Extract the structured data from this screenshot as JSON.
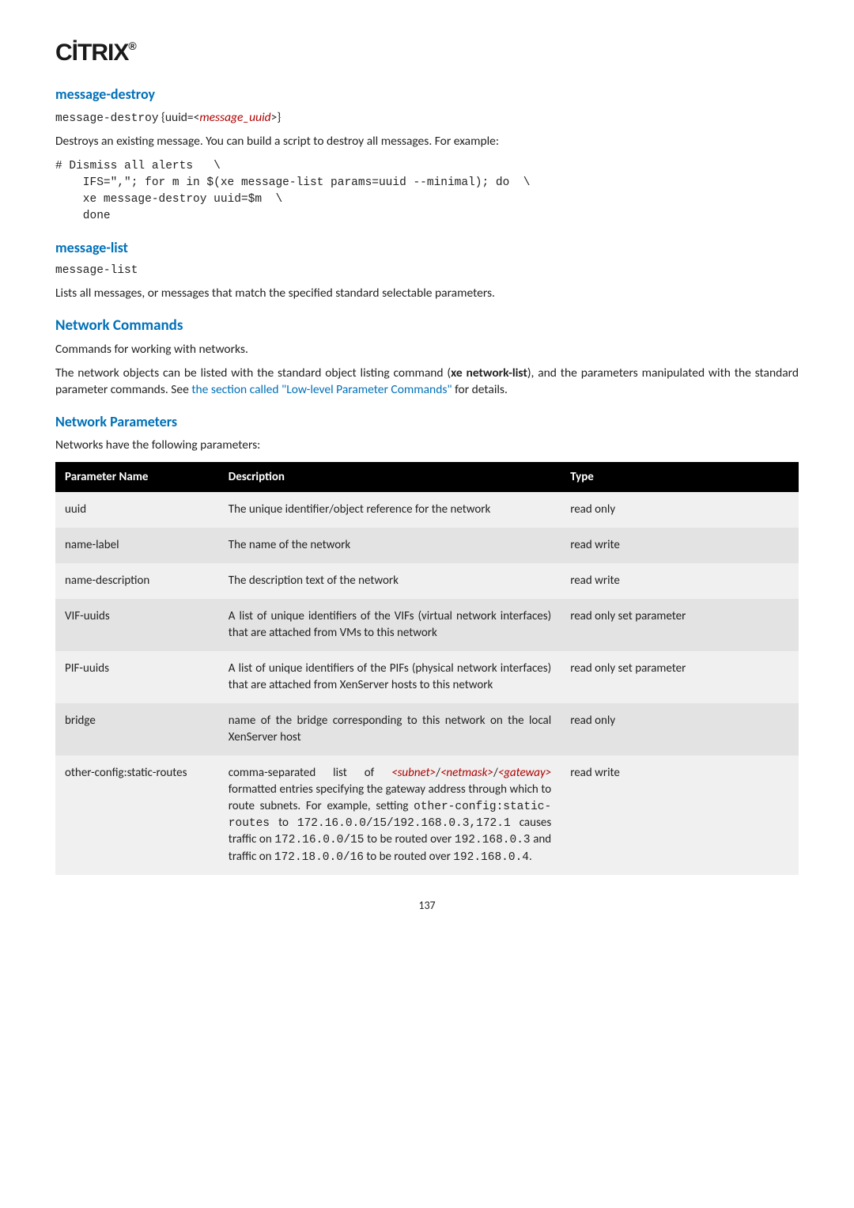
{
  "logo": "CİTRIX",
  "logo_dot": "®",
  "sections": {
    "msg_destroy_title": "message-destroy",
    "msg_destroy_cmd_a": "message-destroy",
    "msg_destroy_cmd_b": " {uuid=<",
    "msg_destroy_cmd_c": "message_uuid",
    "msg_destroy_cmd_d": ">}",
    "msg_destroy_desc": "Destroys an existing message. You can build a script to destroy all messages. For example:",
    "msg_destroy_code": "# Dismiss all alerts   \\\n    IFS=\",\"; for m in $(xe message-list params=uuid --minimal); do  \\\n    xe message-destroy uuid=$m  \\\n    done",
    "msg_list_title": "message-list",
    "msg_list_cmd": "message-list",
    "msg_list_desc": "Lists all messages, or messages that match the specified standard selectable parameters.",
    "network_cmds_title": "Network Commands",
    "network_cmds_desc": "Commands for working with networks.",
    "network_cmds_p2_a": "The network objects can be listed with the standard object listing command (",
    "network_cmds_p2_b": "xe network-list",
    "network_cmds_p2_c": "), and the parameters manipulated with the standard parameter commands. See ",
    "network_cmds_p2_link": "the section called \"Low-level Parameter Commands\"",
    "network_cmds_p2_d": " for details.",
    "network_params_title": "Network Parameters",
    "network_params_desc": "Networks have the following parameters:"
  },
  "table": {
    "headers": {
      "name": "Parameter Name",
      "desc": "Description",
      "type": "Type"
    },
    "rows": [
      {
        "name": "uuid",
        "desc": "The unique identifier/object reference for the network",
        "type": "read only"
      },
      {
        "name": "name-label",
        "desc": "The name of the network",
        "type": "read write"
      },
      {
        "name": "name-description",
        "desc": "The description text of the network",
        "type": "read write"
      },
      {
        "name": "VIF-uuids",
        "desc": "A list of unique identifiers of the VIFs (virtual network interfaces) that are attached from VMs to this network",
        "type": "read only set parameter"
      },
      {
        "name": "PIF-uuids",
        "desc": "A list of unique identifiers of the PIFs (physical network interfaces) that are attached from XenServer hosts to this network",
        "type": "read only set parameter"
      },
      {
        "name": "bridge",
        "desc": "name of the bridge corresponding to this network on the local XenServer host",
        "type": "read only"
      },
      {
        "name": "other-config:static-routes",
        "desc_parts": {
          "a": "comma-separated list of ",
          "subnet": "<subnet>",
          "b": "/",
          "netmask": "<netmask>",
          "c": "/",
          "gateway": "<gateway>",
          "d": " formatted entries specifying the gateway address through which to route subnets. For example, setting ",
          "code1": "other-config:static-routes",
          "e": " to ",
          "code2": "172.16.0.0/15/192.168.0.3,172.1",
          "f": " causes traffic on ",
          "code3": "172.16.0.0/15",
          "g": " to be routed over ",
          "code4": "192.168.0.3",
          "h": " and traffic on ",
          "code5": "172.18.0.0/16",
          "i": " to be routed over ",
          "code6": "192.168.0.4",
          "j": "."
        },
        "type": "read write"
      }
    ]
  },
  "pagenum": "137"
}
